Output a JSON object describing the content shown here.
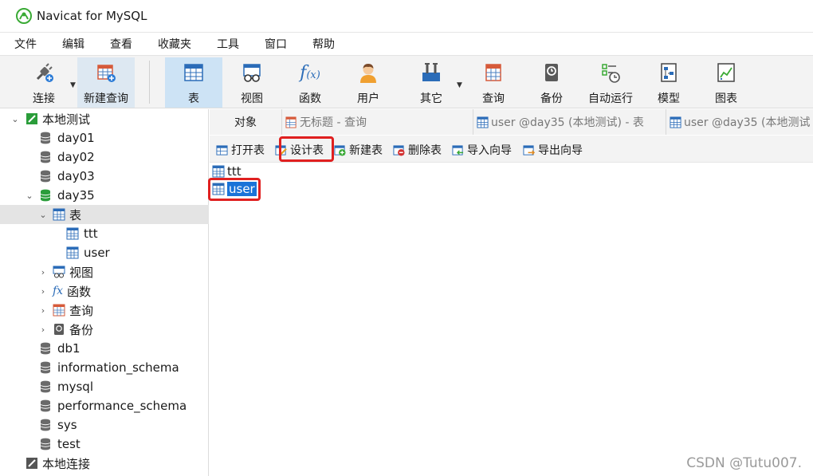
{
  "window": {
    "title": "Navicat for MySQL"
  },
  "menu": [
    "文件",
    "编辑",
    "查看",
    "收藏夹",
    "工具",
    "窗口",
    "帮助"
  ],
  "toolbar": {
    "connect": "连接",
    "new_query": "新建查询",
    "table": "表",
    "view": "视图",
    "function": "函数",
    "user": "用户",
    "other": "其它",
    "query": "查询",
    "backup": "备份",
    "auto_run": "自动运行",
    "model": "模型",
    "chart": "图表"
  },
  "sidebar": {
    "connection": "本地测试",
    "databases_top": [
      "day01",
      "day02",
      "day03"
    ],
    "open_db": "day35",
    "tables_node": "表",
    "tables": [
      "ttt",
      "user"
    ],
    "sub_nodes": [
      "视图",
      "函数",
      "查询",
      "备份"
    ],
    "databases_bottom": [
      "db1",
      "information_schema",
      "mysql",
      "performance_schema",
      "sys",
      "test"
    ],
    "other_connection": "本地连接"
  },
  "tabs": {
    "objects": "对象",
    "untitled_query": "无标题 - 查询",
    "user_table_1": "user @day35 (本地测试) - 表",
    "user_table_2": "user @day35 (本地测试"
  },
  "object_toolbar": {
    "open": "打开表",
    "design": "设计表",
    "new": "新建表",
    "delete": "删除表",
    "import": "导入向导",
    "export": "导出向导"
  },
  "object_list": [
    "ttt",
    "user"
  ],
  "watermark": "CSDN @Tutu007.",
  "colors": {
    "accent": "#1a73d8",
    "highlight": "#e02020",
    "db_open": "#2a9d3a"
  }
}
